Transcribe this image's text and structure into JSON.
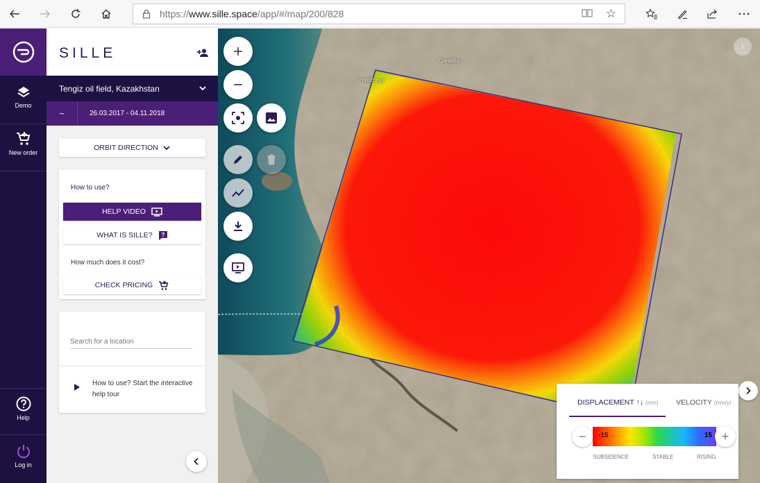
{
  "browser": {
    "url_prefix": "https://",
    "url_host": "www.sille.space",
    "url_path": "/app/#/map/200/828"
  },
  "rail": {
    "items": [
      {
        "label": "Demo",
        "icon": "layers-icon"
      },
      {
        "label": "New order",
        "icon": "cart-plus-icon"
      },
      {
        "label": "Help",
        "icon": "help-circle-icon"
      },
      {
        "label": "Log in",
        "icon": "power-icon"
      }
    ]
  },
  "panel": {
    "brand": "SILLE",
    "project_name": "Tengiz oil field, Kazakhstan",
    "tilde": "~",
    "date_range": "26.03.2017 - 04.11.2018",
    "orbit_label": "ORBIT DIRECTION",
    "how_to_use": "How to use?",
    "help_video": "HELP VIDEO",
    "what_is_sille": "WHAT IS SILLE?",
    "how_much": "How much does it cost?",
    "check_pricing": "CHECK PRICING",
    "search_placeholder": "Search for a location",
    "tour_text": "How to use? Start the interactive help tour"
  },
  "map": {
    "labels": {
      "karamola": "Qarasila",
      "prorva": "Prirezhnyy"
    },
    "info": "i",
    "controls": [
      "zoom-in",
      "zoom-out",
      "fit-bounds",
      "basemap",
      "draw",
      "delete",
      "chart",
      "download",
      "video"
    ],
    "colors": {
      "high_subsidence": "#ff0000",
      "stable": "#2cd94a",
      "rising": "#2d6dff",
      "aoi_border": "#3d2e7a"
    }
  },
  "legend": {
    "tab_displacement": "DISPLACEMENT ↑↓",
    "tab_displacement_unit": "(mm)",
    "tab_velocity": "VELOCITY",
    "tab_velocity_unit": "(mm/y)",
    "scale_min": "-15",
    "scale_max": "15",
    "minus": "−",
    "plus": "+",
    "cap_left": "SUBSIDENCE",
    "cap_mid": "STABLE",
    "cap_right": "RISING"
  }
}
